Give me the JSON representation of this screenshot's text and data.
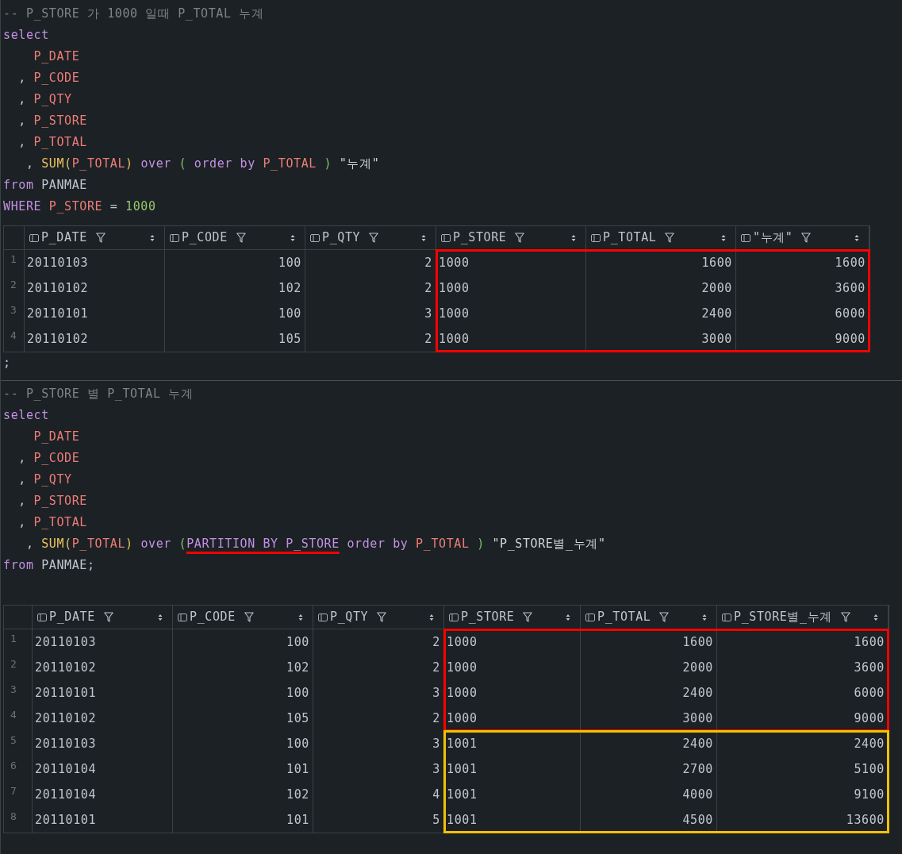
{
  "sections": [
    {
      "kind": "code",
      "lines": [
        [
          {
            "kind": "comment",
            "text": "-- P_STORE 가 1000 일때 P_TOTAL 누계"
          }
        ],
        [
          {
            "kind": "keyword",
            "text": "select"
          }
        ],
        [
          {
            "kind": "column",
            "text": "    P_DATE"
          }
        ],
        [
          {
            "kind": "plain",
            "text": "  , "
          },
          {
            "kind": "column",
            "text": "P_CODE"
          }
        ],
        [
          {
            "kind": "plain",
            "text": "  , "
          },
          {
            "kind": "column",
            "text": "P_QTY"
          }
        ],
        [
          {
            "kind": "plain",
            "text": "  , "
          },
          {
            "kind": "column",
            "text": "P_STORE"
          }
        ],
        [
          {
            "kind": "plain",
            "text": "  , "
          },
          {
            "kind": "column",
            "text": "P_TOTAL"
          }
        ],
        [
          {
            "kind": "plain",
            "text": "   , "
          },
          {
            "kind": "function",
            "text": "SUM("
          },
          {
            "kind": "column",
            "text": "P_TOTAL"
          },
          {
            "kind": "function",
            "text": ")"
          },
          {
            "kind": "keyword",
            "text": " over"
          },
          {
            "kind": "paren",
            "text": " ("
          },
          {
            "kind": "keyword",
            "text": " order by"
          },
          {
            "kind": "column",
            "text": " P_TOTAL"
          },
          {
            "kind": "paren",
            "text": " )"
          },
          {
            "kind": "string",
            "text": " \"누계\""
          }
        ],
        [
          {
            "kind": "keyword",
            "text": "from"
          },
          {
            "kind": "plain",
            "text": " PANMAE"
          }
        ],
        [
          {
            "kind": "keyword",
            "text": "WHERE"
          },
          {
            "kind": "column",
            "text": " P_STORE"
          },
          {
            "kind": "plain",
            "text": " = "
          },
          {
            "kind": "number",
            "text": "1000"
          }
        ]
      ]
    },
    {
      "kind": "grid",
      "columns": [
        "P_DATE",
        "P_CODE",
        "P_QTY",
        "P_STORE",
        "P_TOTAL",
        "\"누계\""
      ],
      "groups": [
        {
          "color": "#ff0000",
          "rows": [
            {
              "num": "1",
              "cells": [
                "20110103",
                "100",
                "2",
                "1000",
                "1600",
                "1600"
              ]
            },
            {
              "num": "2",
              "cells": [
                "20110102",
                "102",
                "2",
                "1000",
                "2000",
                "3600"
              ]
            },
            {
              "num": "3",
              "cells": [
                "20110101",
                "100",
                "3",
                "1000",
                "2400",
                "6000"
              ]
            },
            {
              "num": "4",
              "cells": [
                "20110102",
                "105",
                "2",
                "1000",
                "3000",
                "9000"
              ]
            }
          ]
        }
      ]
    },
    {
      "kind": "code",
      "lines": [
        [
          {
            "kind": "plain",
            "text": ";"
          }
        ]
      ]
    },
    {
      "kind": "divider"
    },
    {
      "kind": "code",
      "lines": [
        [
          {
            "kind": "comment",
            "text": "-- P_STORE 별 P_TOTAL 누계"
          }
        ],
        [
          {
            "kind": "keyword",
            "text": "select"
          }
        ],
        [
          {
            "kind": "column",
            "text": "    P_DATE"
          }
        ],
        [
          {
            "kind": "plain",
            "text": "  , "
          },
          {
            "kind": "column",
            "text": "P_CODE"
          }
        ],
        [
          {
            "kind": "plain",
            "text": "  , "
          },
          {
            "kind": "column",
            "text": "P_QTY"
          }
        ],
        [
          {
            "kind": "plain",
            "text": "  , "
          },
          {
            "kind": "column",
            "text": "P_STORE"
          }
        ],
        [
          {
            "kind": "plain",
            "text": "  , "
          },
          {
            "kind": "column",
            "text": "P_TOTAL"
          }
        ],
        [
          {
            "kind": "plain",
            "text": "   , "
          },
          {
            "kind": "function",
            "text": "SUM("
          },
          {
            "kind": "column",
            "text": "P_TOTAL"
          },
          {
            "kind": "function",
            "text": ")"
          },
          {
            "kind": "keyword",
            "text": " over"
          },
          {
            "kind": "paren",
            "text": " ("
          },
          {
            "kind": "keyword",
            "text": "PARTITION BY P_STORE",
            "underlined": true
          },
          {
            "kind": "keyword",
            "text": " order by"
          },
          {
            "kind": "column",
            "text": " P_TOTAL"
          },
          {
            "kind": "paren",
            "text": " )"
          },
          {
            "kind": "string",
            "text": " \"P_STORE별_누계\""
          }
        ],
        [
          {
            "kind": "keyword",
            "text": "from"
          },
          {
            "kind": "plain",
            "text": " PANMAE;"
          }
        ]
      ]
    },
    {
      "kind": "grid",
      "columns": [
        "P_DATE",
        "P_CODE",
        "P_QTY",
        "P_STORE",
        "P_TOTAL",
        "P_STORE별_누계"
      ],
      "groups": [
        {
          "color": "#ff0000",
          "rows": [
            {
              "num": "1",
              "cells": [
                "20110103",
                "100",
                "2",
                "1000",
                "1600",
                "1600"
              ]
            },
            {
              "num": "2",
              "cells": [
                "20110102",
                "102",
                "2",
                "1000",
                "2000",
                "3600"
              ]
            },
            {
              "num": "3",
              "cells": [
                "20110101",
                "100",
                "3",
                "1000",
                "2400",
                "6000"
              ]
            },
            {
              "num": "4",
              "cells": [
                "20110102",
                "105",
                "2",
                "1000",
                "3000",
                "9000"
              ]
            }
          ]
        },
        {
          "color": "#f2c200",
          "rows": [
            {
              "num": "5",
              "cells": [
                "20110103",
                "100",
                "3",
                "1001",
                "2400",
                "2400"
              ]
            },
            {
              "num": "6",
              "cells": [
                "20110104",
                "101",
                "3",
                "1001",
                "2700",
                "5100"
              ]
            },
            {
              "num": "7",
              "cells": [
                "20110104",
                "102",
                "4",
                "1001",
                "4000",
                "9100"
              ]
            },
            {
              "num": "8",
              "cells": [
                "20110101",
                "101",
                "5",
                "1001",
                "4500",
                "13600"
              ]
            }
          ]
        }
      ]
    }
  ]
}
